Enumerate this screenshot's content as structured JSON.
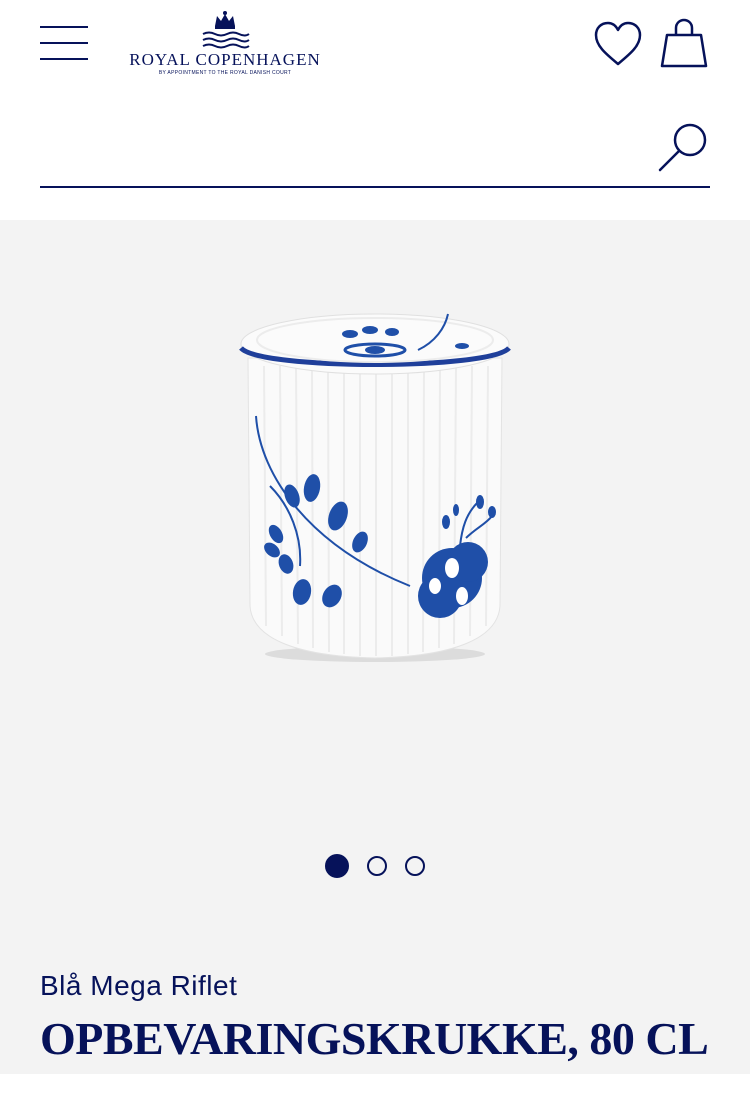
{
  "header": {
    "logo_text": "ROYAL COPENHAGEN",
    "logo_subtext": "BY APPOINTMENT TO THE ROYAL DANISH COURT",
    "menu_icon": "hamburger-menu-icon",
    "wishlist_icon": "heart-icon",
    "bag_icon": "shopping-bag-icon",
    "search_icon": "search-icon"
  },
  "search": {
    "value": "",
    "placeholder": ""
  },
  "gallery": {
    "image_alt": "",
    "current_slide": 1,
    "total_slides": 3
  },
  "product": {
    "collection": "Blå Mega Riflet",
    "title": "OPBEVARINGSKRUKKE, 80 CL"
  },
  "colors": {
    "brand": "#06125a",
    "background_gallery": "#f3f3f3",
    "pattern_blue": "#1f4fa8"
  }
}
